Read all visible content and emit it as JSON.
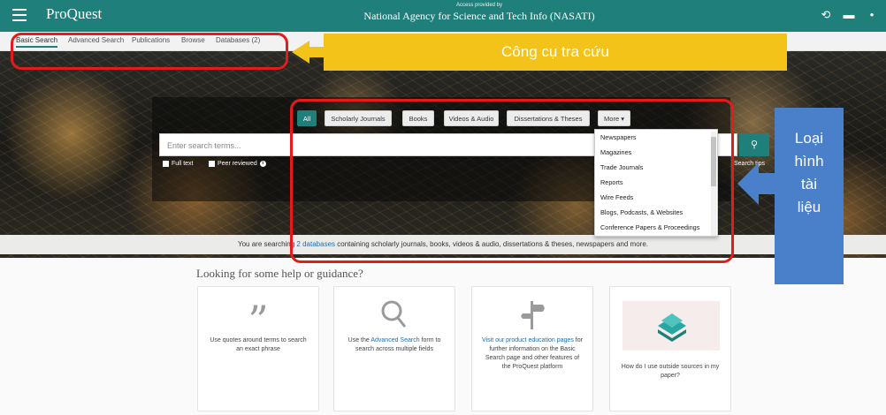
{
  "topbar": {
    "logo": "ProQuest",
    "access_small": "Access provided by",
    "access_name": "National Agency for Science and Tech Info (NASATI)",
    "icons": [
      "menu-icon",
      "history-icon",
      "folder-icon",
      "user-icon"
    ]
  },
  "nav": {
    "items": [
      {
        "label": "Basic Search",
        "active": true
      },
      {
        "label": "Advanced Search"
      },
      {
        "label": "Publications"
      },
      {
        "label": "Browse"
      },
      {
        "label": "Databases (2)"
      }
    ]
  },
  "search": {
    "tabs": [
      {
        "label": "All",
        "active": true
      },
      {
        "label": "Scholarly Journals"
      },
      {
        "label": "Books"
      },
      {
        "label": "Videos & Audio"
      },
      {
        "label": "Dissertations & Theses"
      },
      {
        "label": "More ▾"
      }
    ],
    "placeholder": "Enter search terms...",
    "full_text": "Full text",
    "peer_reviewed": "Peer reviewed",
    "tips": "Search tips"
  },
  "dropdown": {
    "options": [
      "Newspapers",
      "Magazines",
      "Trade Journals",
      "Reports",
      "Wire Feeds",
      "Blogs, Podcasts, & Websites",
      "Conference Papers & Proceedings"
    ]
  },
  "strip": {
    "pre": "You are searching ",
    "link": "2 databases",
    "post": " containing scholarly journals, books, videos & audio, dissertations & theses, newspapers and more."
  },
  "help": {
    "title": "Looking for some help or guidance?",
    "card1": {
      "text": "Use quotes around terms to search an exact phrase"
    },
    "card2": {
      "pre": "Use the ",
      "link": "Advanced Search",
      "post": " form to search across multiple fields"
    },
    "card3": {
      "link": "Visit our product education pages",
      "post": " for further information on the Basic Search page and other features of the ProQuest platform"
    },
    "card4": {
      "text": "How do I use outside sources in my paper?"
    }
  },
  "annotations": {
    "tool_label": "Công cụ tra cứu",
    "type_label_lines": [
      "Loại",
      "hình",
      "tài",
      "liệu"
    ],
    "red": "#e31b1b",
    "yellow": "#f4c319",
    "blue": "#4a7fc9"
  },
  "colors": {
    "brand": "#1f7f7b",
    "link": "#1f6fb2"
  }
}
